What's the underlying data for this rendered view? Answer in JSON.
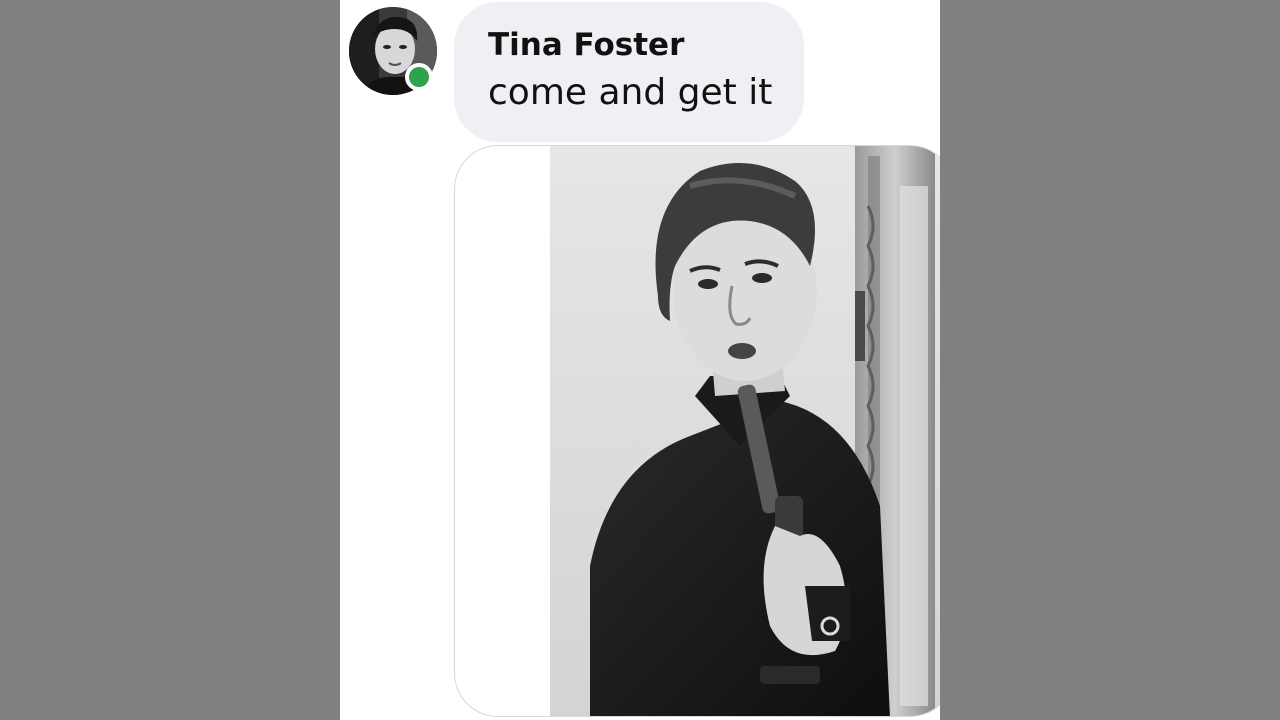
{
  "message": {
    "sender_name": "Tina Foster",
    "text": "come and get it",
    "sender_online": true
  },
  "avatar": {
    "icon": "profile-photo",
    "status_color": "#31a24c"
  },
  "attachment": {
    "type": "photo",
    "style": "black-and-white"
  },
  "colors": {
    "bubble_background": "#eef0f3",
    "page_background": "#ffffff",
    "outer_background": "#808080",
    "presence_green": "#31a24c"
  }
}
